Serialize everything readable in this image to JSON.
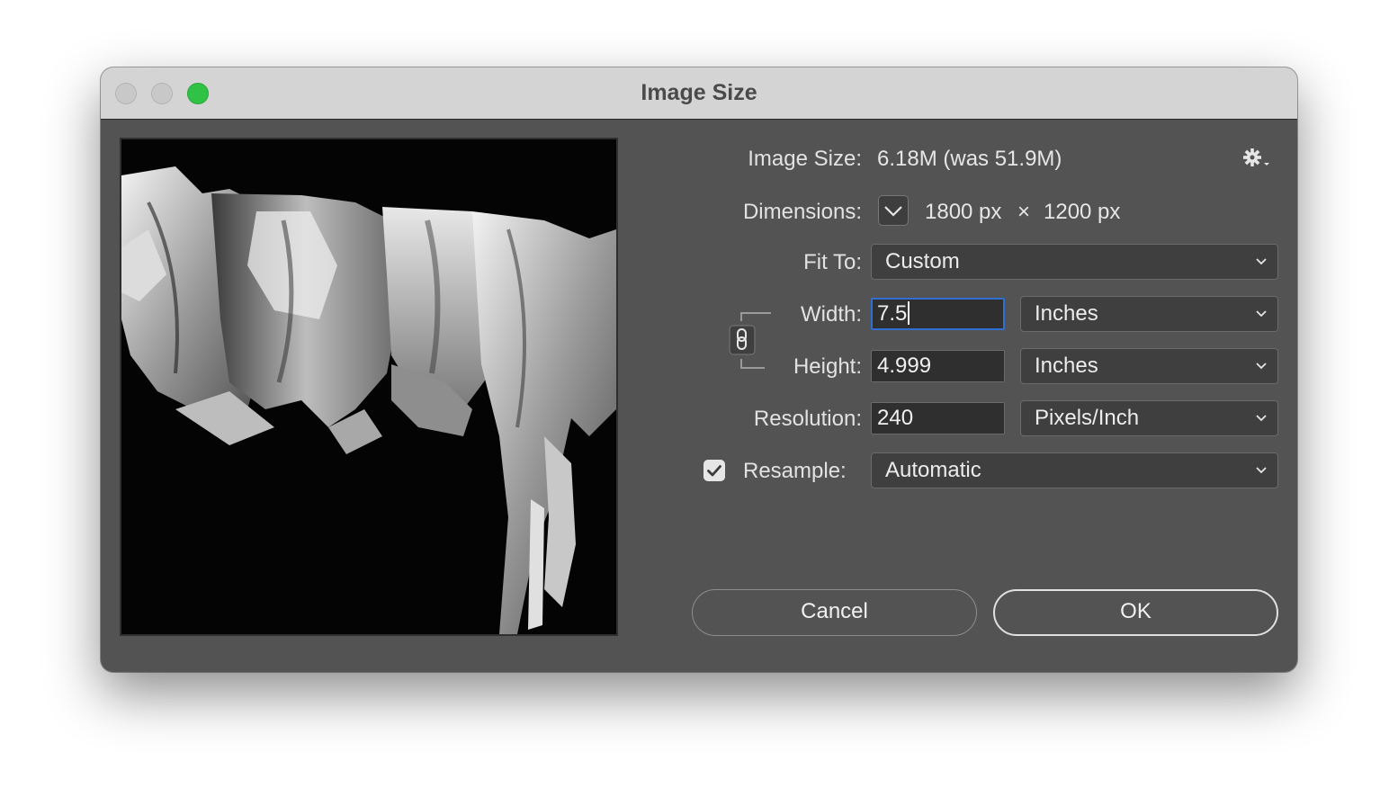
{
  "window": {
    "title": "Image Size"
  },
  "info": {
    "image_size_label": "Image Size:",
    "image_size_value": "6.18M (was 51.9M)",
    "dimensions_label": "Dimensions:",
    "dim_width": "1800 px",
    "dim_times": "×",
    "dim_height": "1200 px"
  },
  "fit_to": {
    "label": "Fit To:",
    "value": "Custom"
  },
  "width": {
    "label": "Width:",
    "value": "7.5",
    "unit": "Inches"
  },
  "height": {
    "label": "Height:",
    "value": "4.999",
    "unit": "Inches"
  },
  "resolution": {
    "label": "Resolution:",
    "value": "240",
    "unit": "Pixels/Inch"
  },
  "resample": {
    "label": "Resample:",
    "checked": true,
    "value": "Automatic"
  },
  "buttons": {
    "cancel": "Cancel",
    "ok": "OK"
  },
  "colors": {
    "dialog_bg": "#535353",
    "focus_ring": "#2f6fd1",
    "zoom_button": "#2fc244"
  },
  "icons": [
    "gear-icon",
    "chevron-down-icon",
    "link-icon",
    "checkmark-icon"
  ]
}
